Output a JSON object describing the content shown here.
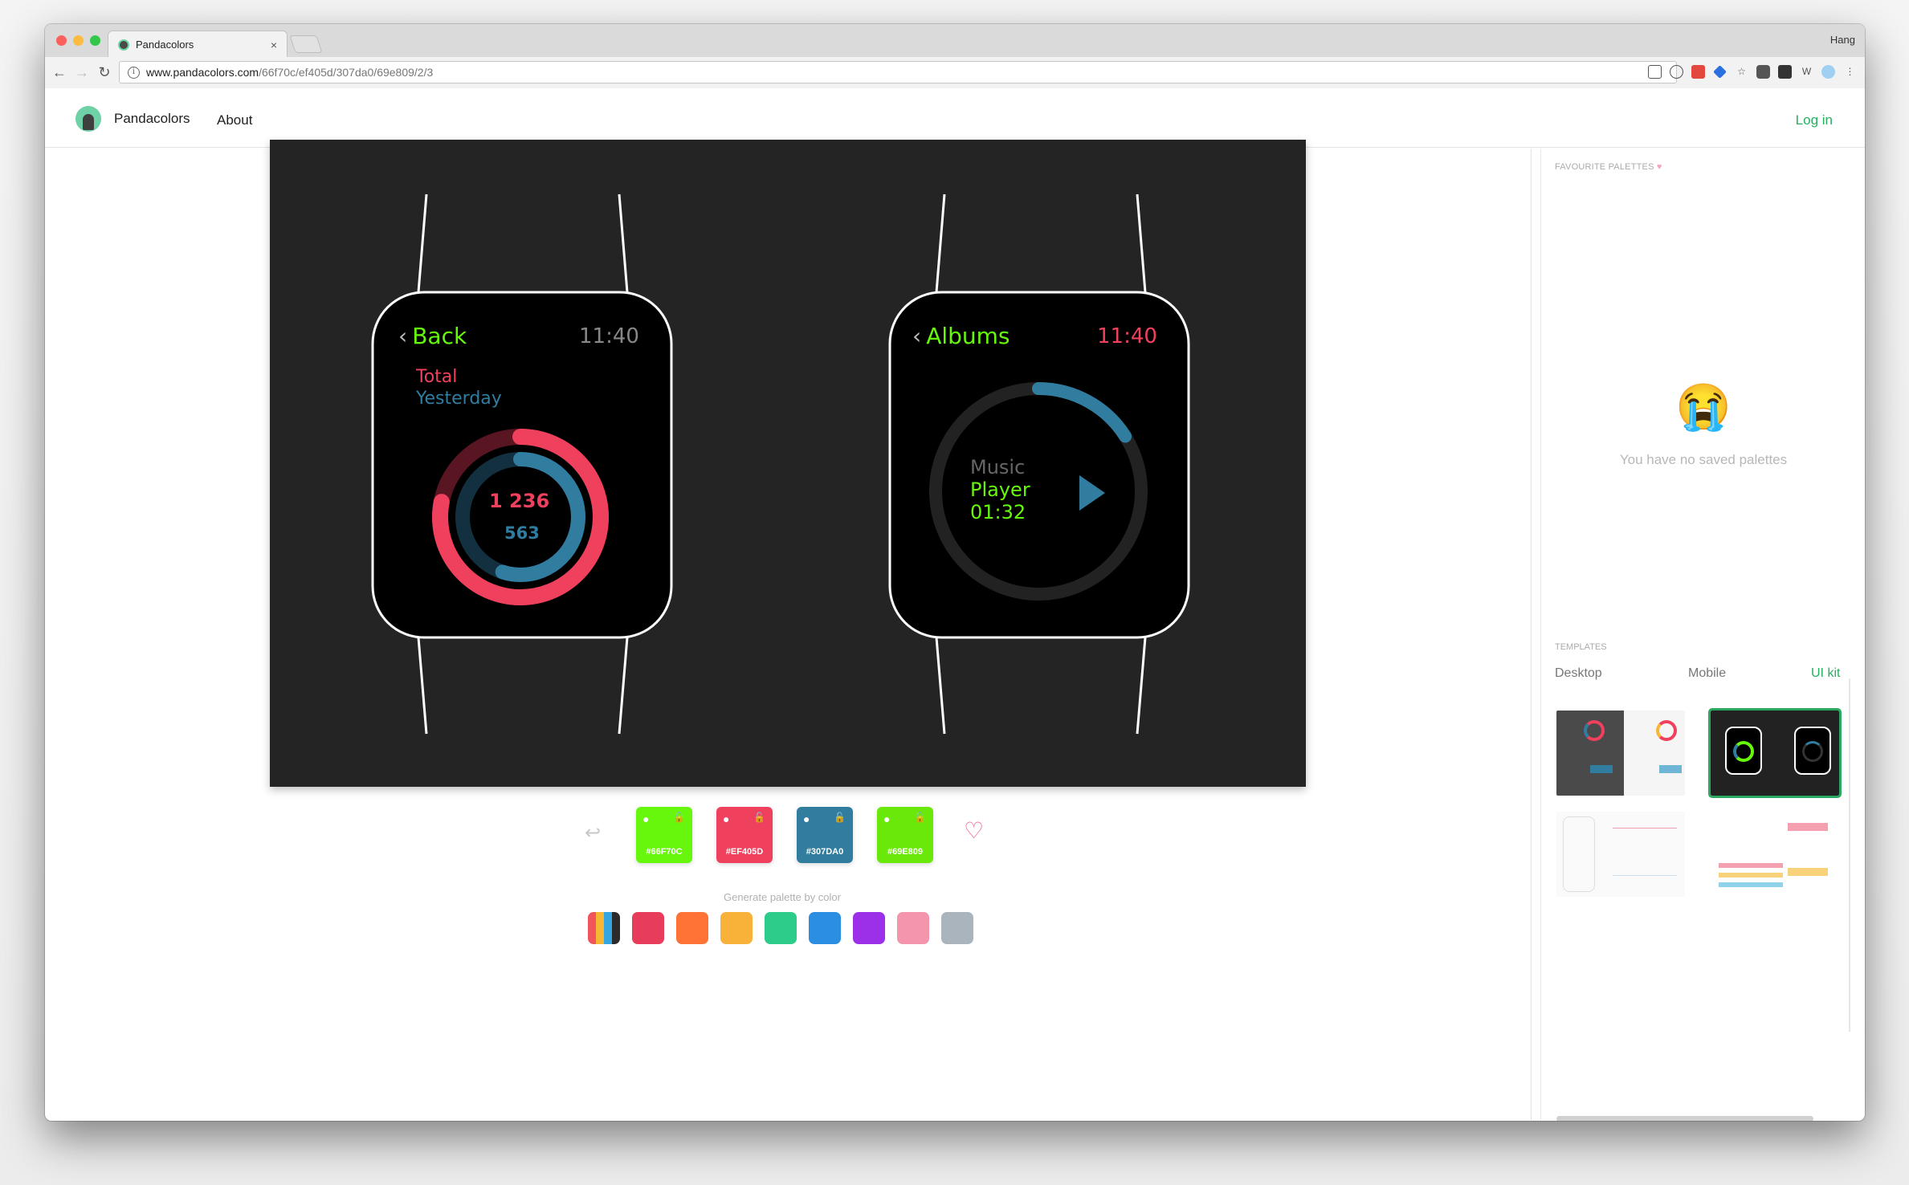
{
  "browser": {
    "tab_title": "Pandacolors",
    "close": "×",
    "profile_name": "Hang",
    "url_host": "www.pandacolors.com",
    "url_path": "/66f70c/ef405d/307da0/69e809/2/3",
    "info_glyph": "i",
    "back_glyph": "←",
    "forward_glyph": "→",
    "reload_glyph": "↻"
  },
  "site": {
    "brand": "Pandacolors",
    "about": "About",
    "login": "Log in"
  },
  "watch_left": {
    "back": "Back",
    "chevron": "‹",
    "time": "11:40",
    "total": "Total",
    "yesterday": "Yesterday",
    "value_total": "1 236",
    "value_yesterday": "563",
    "progress_total": 0.78,
    "progress_yesterday": 0.55
  },
  "watch_right": {
    "back": "Albums",
    "chevron": "‹",
    "time": "11:40",
    "music": "Music",
    "player": "Player",
    "elapsed": "01:32",
    "progress": 0.16
  },
  "palette": {
    "undo_glyph": "↩",
    "drop_glyph": "●",
    "lock_glyph": "🔓",
    "heart_glyph": "♡",
    "swatches": [
      {
        "hex": "#66F70C",
        "color": "#66f70c"
      },
      {
        "hex": "#EF405D",
        "color": "#ef405d"
      },
      {
        "hex": "#307DA0",
        "color": "#307da0"
      },
      {
        "hex": "#69E809",
        "color": "#69e809"
      }
    ]
  },
  "generate": {
    "label": "Generate palette by color",
    "colors": [
      "multi",
      "#e83d5a",
      "#ff7337",
      "#f8b23a",
      "#2ecc8a",
      "#2b8ee0",
      "#9b30e8",
      "#f495ac",
      "#aab4bd"
    ]
  },
  "sidebar": {
    "favourites_label": "FAVOURITE PALETTES",
    "heart": "♥",
    "emoji": "😭",
    "empty_text": "You have no saved palettes",
    "templates_label": "TEMPLATES",
    "tabs": [
      "Desktop",
      "Mobile",
      "UI kit"
    ],
    "active_tab": "UI kit"
  }
}
